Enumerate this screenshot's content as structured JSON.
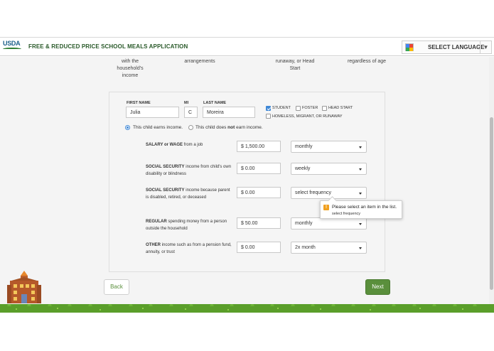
{
  "header": {
    "logo_text": "USDA",
    "title": "FREE & REDUCED PRICE SCHOOL MEALS APPLICATION",
    "language_label": "SELECT LANGUAGE"
  },
  "partial_headings": {
    "col1": "with the household's income",
    "col2": "arrangements",
    "col3": "runaway, or Head Start",
    "col4": "regardless of age"
  },
  "child": {
    "first_name_label": "FIRST NAME",
    "first_name_value": "Julia",
    "mi_label": "MI",
    "mi_value": "C",
    "last_name_label": "LAST NAME",
    "last_name_value": "Moreira",
    "statuses": [
      {
        "label": "STUDENT",
        "checked": true
      },
      {
        "label": "FOSTER",
        "checked": false
      },
      {
        "label": "HEAD START",
        "checked": false
      },
      {
        "label": "HOMELESS, MIGRANT, OR RUNAWAY",
        "checked": false
      }
    ]
  },
  "income_choice": {
    "earns_label": "This child earns income.",
    "not_earn_prefix": "This child does ",
    "not_earn_bold": "not",
    "not_earn_suffix": " earn income.",
    "selected": "earns"
  },
  "income_rows": [
    {
      "bold": "SALARY or WAGE",
      "rest": " from a job",
      "amount": "$ 1,500.00",
      "frequency": "monthly"
    },
    {
      "bold": "SOCIAL SECURITY",
      "rest": " income from child's own disability or blindness",
      "amount": "$ 0.00",
      "frequency": "weekly"
    },
    {
      "bold": "SOCIAL SECURITY",
      "rest": " income because parent is disabled, retired, or deceased",
      "amount": "$ 0.00",
      "frequency": "select frequency"
    },
    {
      "bold": "REGULAR",
      "rest": " spending money from a person outside the household",
      "amount": "$ 50.00",
      "frequency": "monthly"
    },
    {
      "bold": "OTHER",
      "rest": " income such as from a pension fund, annuity, or trust",
      "amount": "$ 0.00",
      "frequency": "2x month"
    }
  ],
  "validation_tooltip": {
    "icon": "warning-icon",
    "message": "Please select an item in the list.",
    "detail": "select frequency"
  },
  "nav": {
    "back_label": "Back",
    "next_label": "Next"
  },
  "colors": {
    "accent_green": "#5a8f3c",
    "checkbox_blue": "#3f88d6",
    "grass": "#5a9e2a"
  }
}
